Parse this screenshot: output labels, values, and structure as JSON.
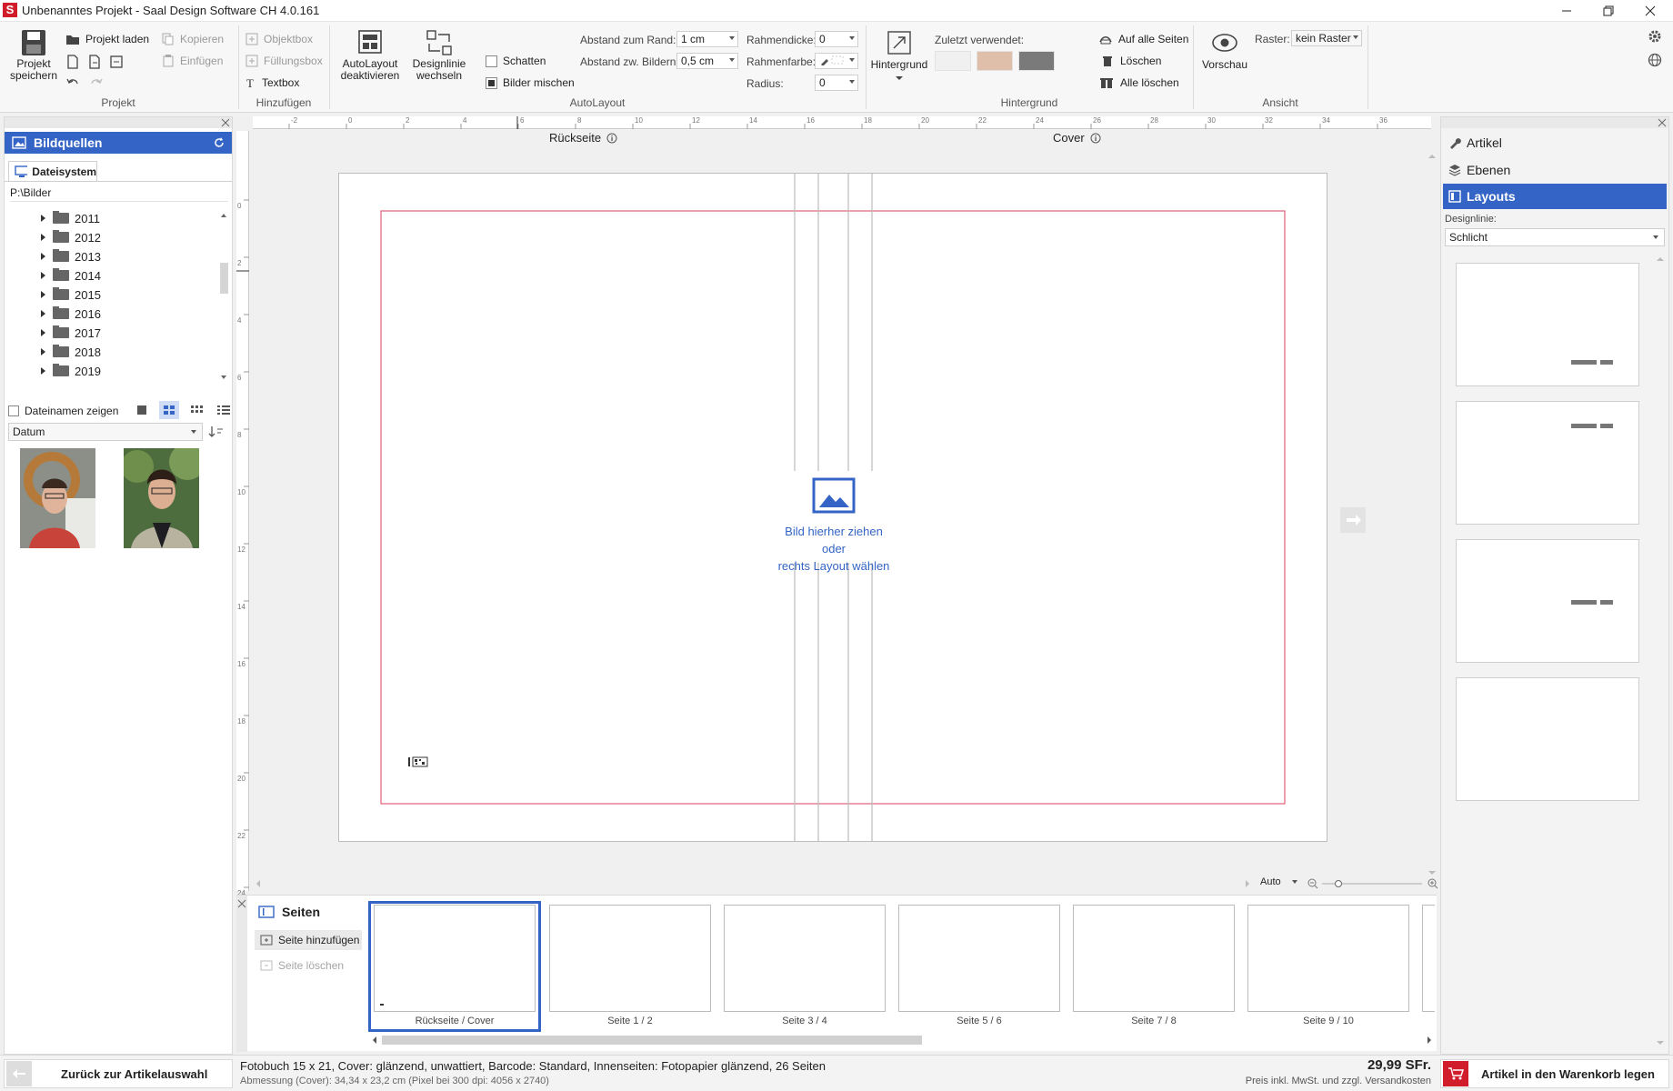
{
  "window": {
    "title": "Unbenanntes Projekt - Saal Design Software CH 4.0.161",
    "logo_letter": "S"
  },
  "ribbon": {
    "projekt": {
      "save": "Projekt speichern",
      "load": "Projekt laden",
      "copy": "Kopieren",
      "paste": "Einfügen",
      "group": "Projekt"
    },
    "hinzufuegen": {
      "objektbox": "Objektbox",
      "fuellungsbox": "Füllungsbox",
      "textbox": "Textbox",
      "group": "Hinzufügen"
    },
    "autolayout": {
      "deactivate": "AutoLayout deaktivieren",
      "designline": "Designlinie wechseln",
      "shadow": "Schatten",
      "mix": "Bilder mischen",
      "rand_label": "Abstand zum Rand:",
      "rand_value": "1 cm",
      "bilder_label": "Abstand zw. Bildern:",
      "bilder_value": "0,5 cm",
      "rdicke_label": "Rahmendicke:",
      "rdicke_value": "0",
      "rfarbe_label": "Rahmenfarbe:",
      "radius_label": "Radius:",
      "radius_value": "0",
      "group": "AutoLayout"
    },
    "hintergrund": {
      "button": "Hintergrund",
      "recent_label": "Zuletzt verwendet:",
      "recent_colors": [
        "#f0f0f0",
        "#dfbfaa",
        "#7a7a7a"
      ],
      "all_pages": "Auf alle Seiten",
      "delete": "Löschen",
      "delete_all": "Alle löschen",
      "group": "Hintergrund"
    },
    "ansicht": {
      "preview": "Vorschau",
      "raster_label": "Raster:",
      "raster_value": "kein Raster",
      "group": "Ansicht"
    }
  },
  "left": {
    "title": "Bildquellen",
    "tab": "Dateisystem",
    "path": "P:\\Bilder",
    "folders": [
      "2011",
      "2012",
      "2013",
      "2014",
      "2015",
      "2016",
      "2017",
      "2018",
      "2019"
    ],
    "show_names": "Dateinamen zeigen",
    "sort": "Datum"
  },
  "canvas": {
    "ruler_h": [
      "-2",
      "0",
      "2",
      "4",
      "6",
      "8",
      "10",
      "12",
      "14",
      "16",
      "18",
      "20",
      "22",
      "24",
      "26",
      "28",
      "30",
      "32",
      "34",
      "36"
    ],
    "ruler_v": [
      "0",
      "2",
      "4",
      "6",
      "8",
      "10",
      "12",
      "14",
      "16",
      "18",
      "20",
      "22",
      "24"
    ],
    "back_label": "Rückseite",
    "cover_label": "Cover",
    "drop_line1": "Bild hierher ziehen",
    "drop_line2": "oder",
    "drop_line3": "rechts Layout wählen",
    "zoom": "Auto"
  },
  "right": {
    "artikel": "Artikel",
    "ebenen": "Ebenen",
    "layouts": "Layouts",
    "designline_label": "Designlinie:",
    "designline_value": "Schlicht"
  },
  "pages": {
    "title": "Seiten",
    "add": "Seite hinzufügen",
    "delete": "Seite löschen",
    "items": [
      "Rückseite / Cover",
      "Seite 1 / 2",
      "Seite 3 / 4",
      "Seite 5 / 6",
      "Seite 7 / 8",
      "Seite 9 / 10"
    ]
  },
  "bottom": {
    "back": "Zurück zur Artikelauswahl",
    "info": "Fotobuch 15 x 21, Cover: glänzend, unwattiert, Barcode: Standard, Innenseiten: Fotopapier glänzend, 26 Seiten",
    "dims": "Abmessung (Cover): 34,34 x 23,2 cm (Pixel bei 300 dpi: 4056 x 2740)",
    "price": "29,99 SFr.",
    "price_note": "Preis inkl. MwSt. und zzgl. Versandkosten",
    "cart": "Artikel in den Warenkorb legen"
  },
  "colors": {
    "accent": "#3465c6",
    "brand": "#d11d2b",
    "margin": "#e0607a"
  }
}
